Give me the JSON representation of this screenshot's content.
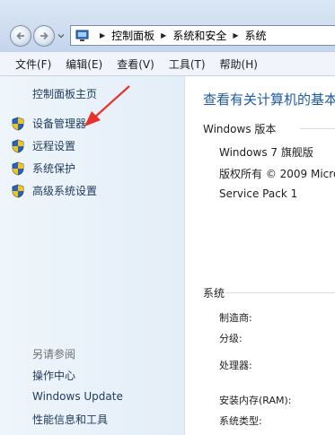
{
  "address_bar": {
    "breadcrumbs": [
      "控制面板",
      "系统和安全",
      "系统"
    ]
  },
  "menu": [
    "文件(F)",
    "编辑(E)",
    "查看(V)",
    "工具(T)",
    "帮助(H)"
  ],
  "sidebar": {
    "home": "控制面板主页",
    "tasks": [
      {
        "label": "设备管理器",
        "icon": "shield-icon"
      },
      {
        "label": "远程设置",
        "icon": "shield-icon"
      },
      {
        "label": "系统保护",
        "icon": "shield-icon"
      },
      {
        "label": "高级系统设置",
        "icon": "shield-icon"
      }
    ],
    "see_also_title": "另请参阅",
    "see_also": [
      "操作中心",
      "Windows Update",
      "性能信息和工具"
    ]
  },
  "main": {
    "heading": "查看有关计算机的基本",
    "windows_edition": {
      "title": "Windows 版本",
      "lines": [
        "Windows 7 旗舰版",
        "版权所有 © 2009 Micro",
        "Service Pack 1"
      ]
    },
    "system": {
      "title": "系统",
      "labels": [
        "制造商:",
        "分级:",
        "处理器:",
        "安装内存(RAM):",
        "系统类型:"
      ]
    }
  },
  "colors": {
    "link": "#1e395b",
    "heading": "#1e5ba5",
    "arrow": "#e8312a",
    "sidebar_bg": "#e4eef8"
  }
}
